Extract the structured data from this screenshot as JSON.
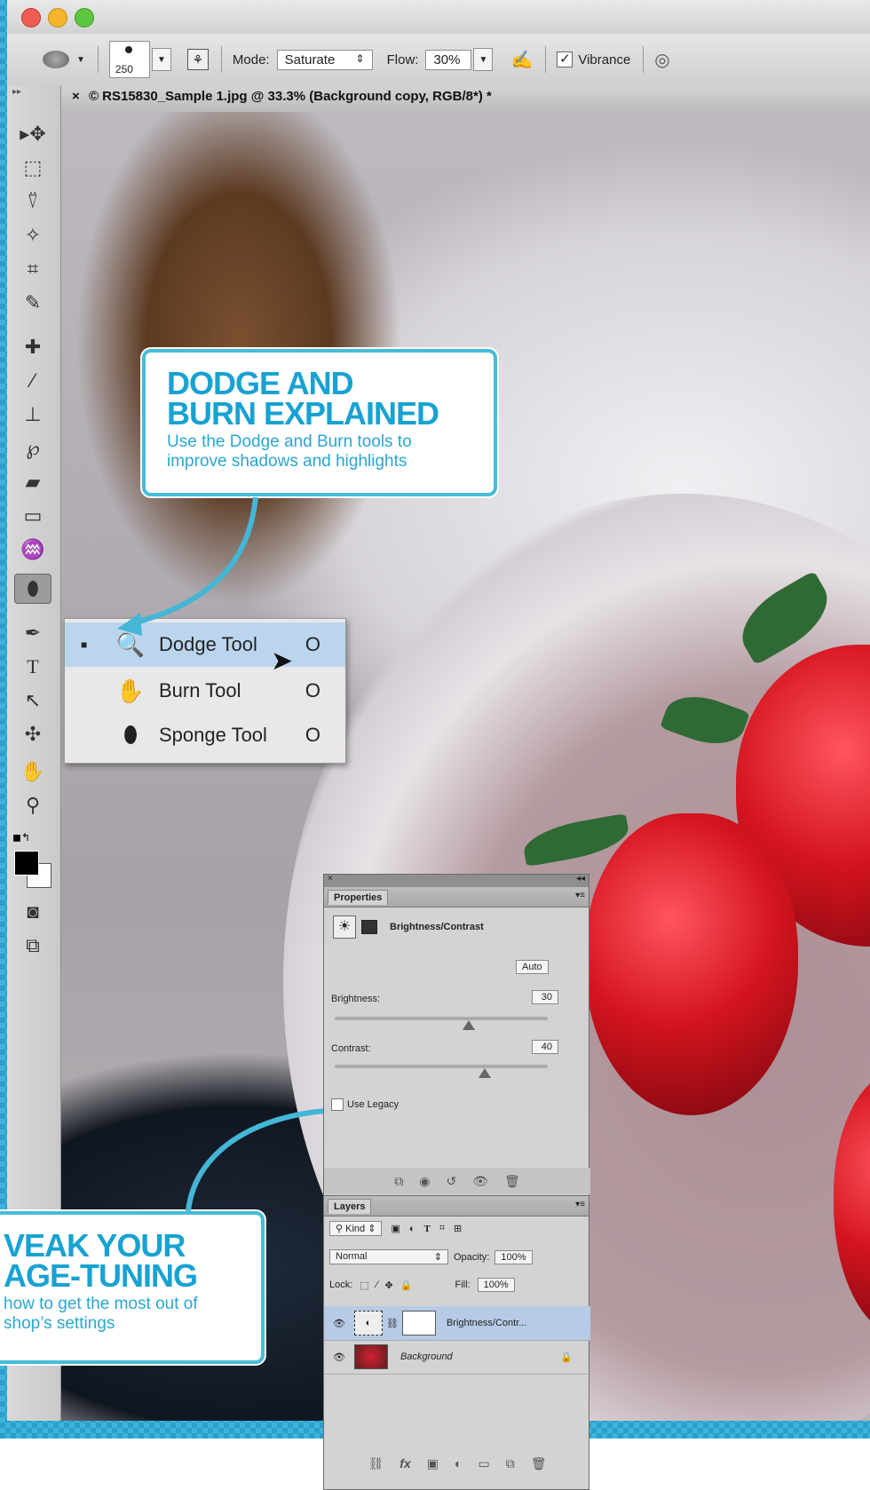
{
  "window": {
    "traffic_colors": [
      "#ee5c52",
      "#f5b62d",
      "#5dc63f"
    ]
  },
  "options_bar": {
    "brush_size": "250",
    "mode_label": "Mode:",
    "mode_value": "Saturate",
    "flow_label": "Flow:",
    "flow_value": "30%",
    "vibrance_label": "Vibrance",
    "vibrance_checked": true
  },
  "document_tab": {
    "title": "© RS15830_Sample 1.jpg @ 33.3% (Background copy, RGB/8*) *"
  },
  "tools": [
    "move-tool-icon",
    "marquee-tool-icon",
    "lasso-tool-icon",
    "quick-selection-tool-icon",
    "crop-tool-icon",
    "eyedropper-tool-icon",
    "healing-brush-tool-icon",
    "brush-tool-icon",
    "clone-stamp-tool-icon",
    "history-brush-tool-icon",
    "eraser-tool-icon",
    "gradient-tool-icon",
    "blur-tool-icon",
    "dodge-tool-icon",
    "pen-tool-icon",
    "type-tool-icon",
    "path-selection-tool-icon",
    "custom-shape-tool-icon",
    "hand-tool-icon",
    "zoom-tool-icon"
  ],
  "flyout": {
    "items": [
      {
        "label": "Dodge Tool",
        "key": "O",
        "selected": true
      },
      {
        "label": "Burn Tool",
        "key": "O",
        "selected": false
      },
      {
        "label": "Sponge Tool",
        "key": "O",
        "selected": false
      }
    ]
  },
  "callout_top": {
    "title_line1": "DODGE AND",
    "title_line2": "BURN EXPLAINED",
    "text_line1": "Use the Dodge and Burn tools to",
    "text_line2": "improve shadows and highlights"
  },
  "callout_bottom": {
    "title_line1": "VEAK YOUR",
    "title_line2": "AGE-TUNING",
    "text_line1": "how to get the most out of",
    "text_line2": "shop’s settings"
  },
  "properties": {
    "tab": "Properties",
    "adjustment": "Brightness/Contrast",
    "auto_label": "Auto",
    "brightness_label": "Brightness:",
    "brightness_value": "30",
    "contrast_label": "Contrast:",
    "contrast_value": "40",
    "legacy_label": "Use Legacy"
  },
  "layers": {
    "tab": "Layers",
    "kind_label": "Kind",
    "blend_mode": "Normal",
    "opacity_label": "Opacity:",
    "opacity_value": "100%",
    "lock_label": "Lock:",
    "fill_label": "Fill:",
    "fill_value": "100%",
    "items": [
      {
        "name": "Brightness/Contr...",
        "selected": true
      },
      {
        "name": "Background",
        "selected": false
      }
    ]
  }
}
